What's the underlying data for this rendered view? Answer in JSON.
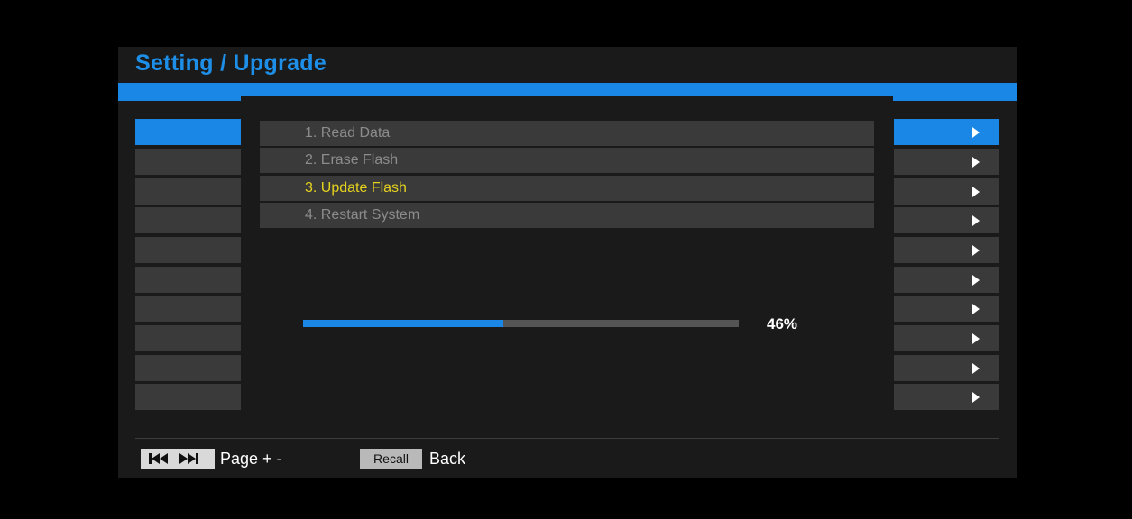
{
  "title": "Setting / Upgrade",
  "steps": [
    {
      "label": "1. Read Data"
    },
    {
      "label": "2. Erase Flash"
    },
    {
      "label": "3. Update Flash"
    },
    {
      "label": "4. Restart System"
    }
  ],
  "current_step": "3. Update Flash",
  "progress": {
    "percent": 46,
    "label": "46%"
  },
  "footer": {
    "page_key_icon": "skip-back-forward-icon",
    "page_label": "Page + -",
    "recall_key": "Recall",
    "back_label": "Back"
  },
  "colors": {
    "accent": "#1a86e6",
    "title": "#1e8fe8",
    "current_step": "#e6d21e",
    "inactive_step": "#8c8c8c"
  }
}
